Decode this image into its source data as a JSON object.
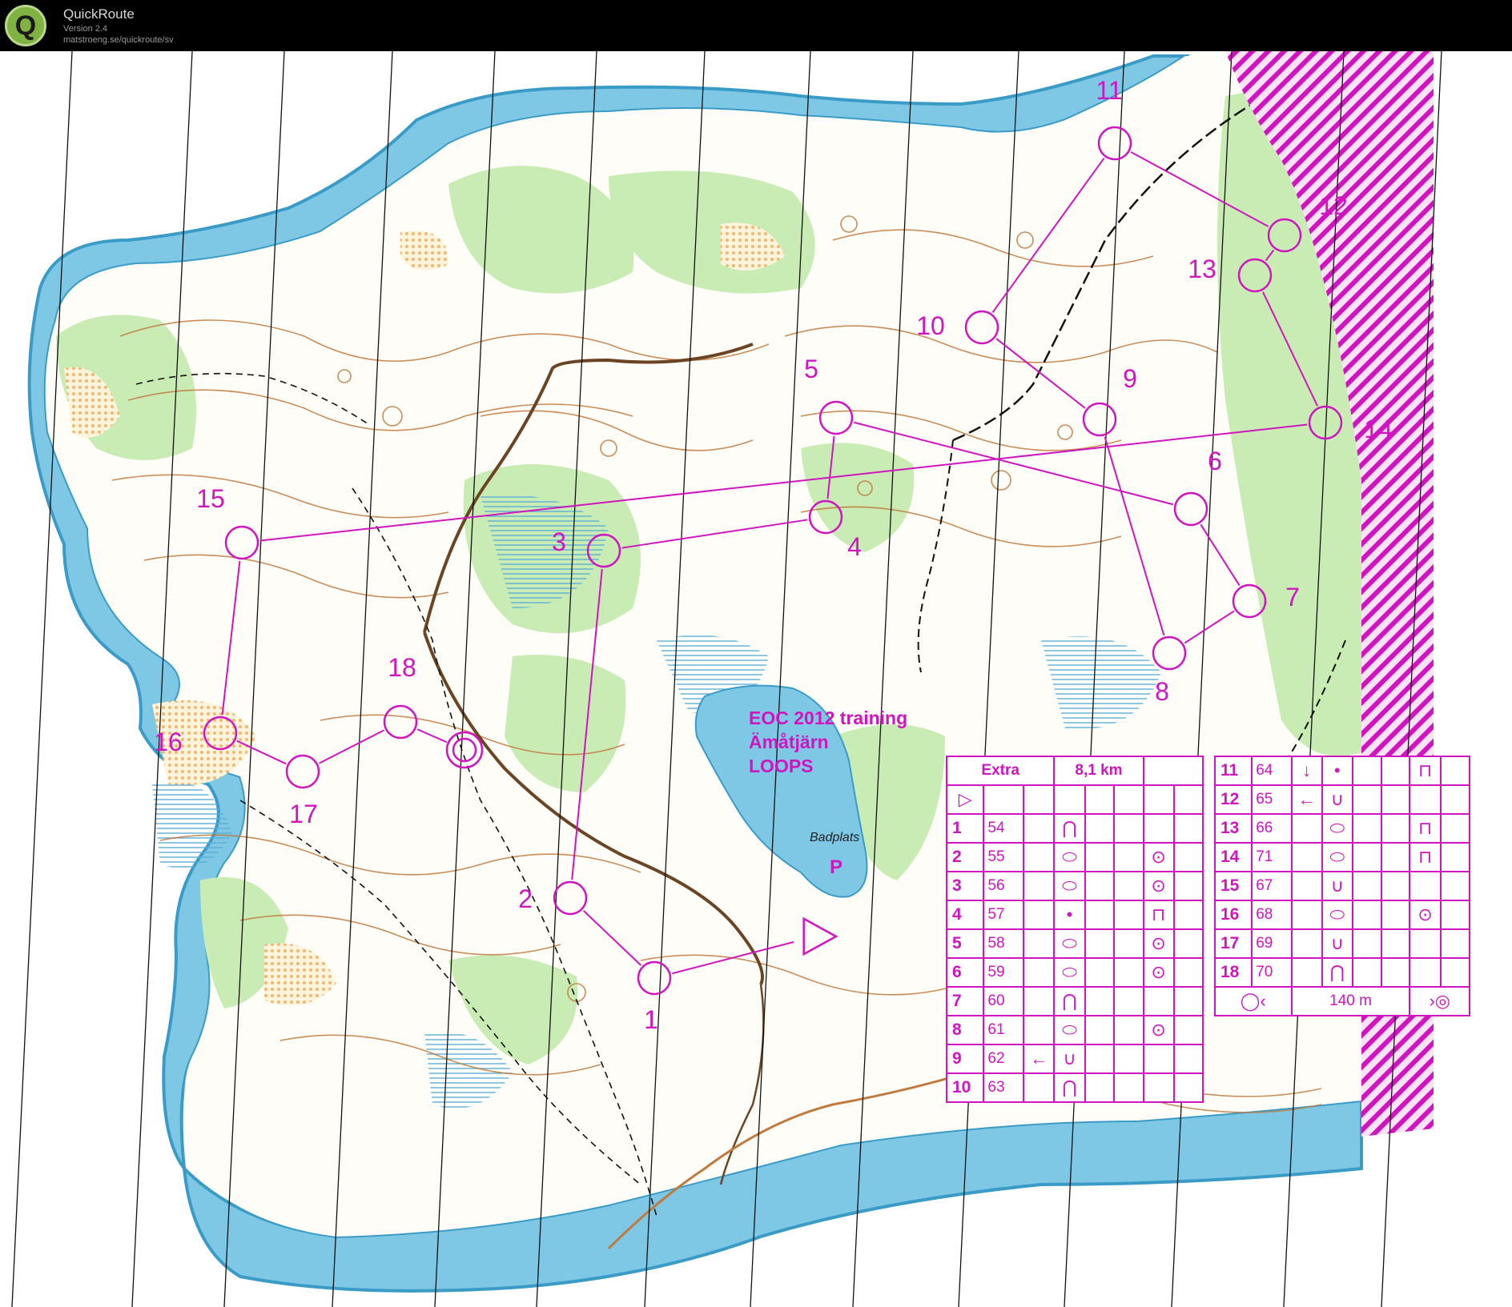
{
  "window": {
    "app_name": "QuickRoute",
    "version": "Version 2.4",
    "url": "matstroeng.se/quickroute/sv",
    "logo_letter": "Q"
  },
  "map": {
    "event_title": [
      "EOC 2012 training",
      "Ämåtjärn",
      "LOOPS"
    ],
    "lake_label": "Badplats",
    "parking_label": "P",
    "overprint_color": "#d015c0",
    "water_color": "#7ec8e6",
    "shore_color": "#3a9bc7",
    "forest_green": "#c9ecb4",
    "open_yellow": "#f8d8a6",
    "contour_brown": "#c07a3d",
    "controls": [
      {
        "label": "1"
      },
      {
        "label": "2"
      },
      {
        "label": "3"
      },
      {
        "label": "4"
      },
      {
        "label": "5"
      },
      {
        "label": "6"
      },
      {
        "label": "7"
      },
      {
        "label": "8"
      },
      {
        "label": "9"
      },
      {
        "label": "10"
      },
      {
        "label": "11"
      },
      {
        "label": "12"
      },
      {
        "label": "13"
      },
      {
        "label": "14"
      },
      {
        "label": "15"
      },
      {
        "label": "16"
      },
      {
        "label": "17"
      },
      {
        "label": "18"
      }
    ]
  },
  "description_left": {
    "header": {
      "name": "Extra",
      "length": "8,1 km"
    },
    "start_symbol": "▷",
    "rows": [
      {
        "num": "1",
        "code": "54",
        "dir": "",
        "feature": "⋂",
        "detail": ""
      },
      {
        "num": "2",
        "code": "55",
        "dir": "",
        "feature": "⬭",
        "detail": "⊙"
      },
      {
        "num": "3",
        "code": "56",
        "dir": "",
        "feature": "⬭",
        "detail": "⊙"
      },
      {
        "num": "4",
        "code": "57",
        "dir": "",
        "feature": "•",
        "detail": "⊓"
      },
      {
        "num": "5",
        "code": "58",
        "dir": "",
        "feature": "⬭",
        "detail": "⊙"
      },
      {
        "num": "6",
        "code": "59",
        "dir": "",
        "feature": "⬭",
        "detail": "⊙"
      },
      {
        "num": "7",
        "code": "60",
        "dir": "",
        "feature": "⋂",
        "detail": ""
      },
      {
        "num": "8",
        "code": "61",
        "dir": "",
        "feature": "⬭",
        "detail": "⊙"
      },
      {
        "num": "9",
        "code": "62",
        "dir": "←",
        "feature": "∪",
        "detail": ""
      },
      {
        "num": "10",
        "code": "63",
        "dir": "",
        "feature": "⋂",
        "detail": ""
      }
    ]
  },
  "description_right": {
    "rows": [
      {
        "num": "11",
        "code": "64",
        "dir": "↓",
        "feature": "•",
        "detail": "⊓"
      },
      {
        "num": "12",
        "code": "65",
        "dir": "←",
        "feature": "∪",
        "detail": ""
      },
      {
        "num": "13",
        "code": "66",
        "dir": "",
        "feature": "⬭",
        "detail": "⊓"
      },
      {
        "num": "14",
        "code": "71",
        "dir": "",
        "feature": "⬭",
        "detail": "⊓"
      },
      {
        "num": "15",
        "code": "67",
        "dir": "",
        "feature": "∪",
        "detail": ""
      },
      {
        "num": "16",
        "code": "68",
        "dir": "",
        "feature": "⬭",
        "detail": "⊙"
      },
      {
        "num": "17",
        "code": "69",
        "dir": "",
        "feature": "∪",
        "detail": ""
      },
      {
        "num": "18",
        "code": "70",
        "dir": "",
        "feature": "⋂",
        "detail": ""
      }
    ],
    "finish": {
      "left_symbol": "◯‹",
      "distance": "140 m",
      "right_symbol": "›◎"
    }
  }
}
